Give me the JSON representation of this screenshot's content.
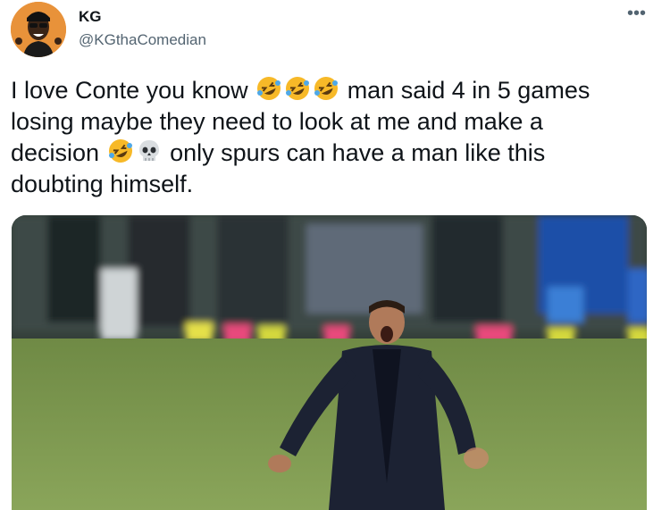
{
  "author": {
    "name": "KG",
    "handle": "@KGthaComedian"
  },
  "menu": {
    "more_label": "•••"
  },
  "tweet": {
    "line1a": "I love Conte you know",
    "line1b": "man said 4 in 5 games",
    "line2": "losing maybe they need to look at me and make a",
    "line3a": "decision",
    "line3b": "only spurs can have a man like this",
    "line4": "doubting himself."
  },
  "icons": [
    "rofl-emoji",
    "skull-emoji"
  ],
  "colors": {
    "handle": "#536471",
    "text": "#0f1419",
    "avatar_bg": "#e8923a",
    "pitch": "#7f9a4e"
  }
}
